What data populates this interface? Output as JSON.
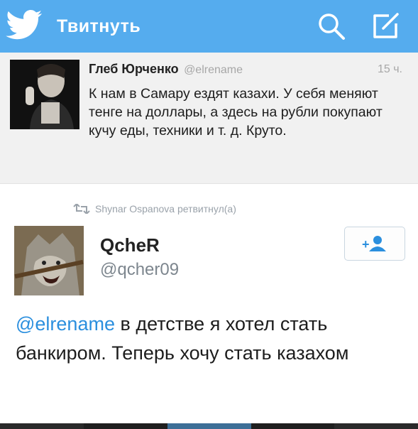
{
  "header": {
    "title": "Твитнуть",
    "brand_color": "#55acee",
    "left_icon": "twitter-bird-icon",
    "search_icon": "search-icon",
    "compose_icon": "compose-icon"
  },
  "original_tweet": {
    "author_name": "Глеб Юрченко",
    "author_handle": "@elrename",
    "time": "15 ч.",
    "text": "К нам в Самару ездят казахи. У себя меняют тенге на доллары, а здесь на рубли покупают кучу еды, техники и т. д. Круто."
  },
  "retweet": {
    "icon": "retweet-icon",
    "text": "Shynar Ospanova ретвитнул(а)"
  },
  "reply_tweet": {
    "author_name": "QcheR",
    "author_handle": "@qcher09",
    "follow_icon": "add-user-icon",
    "mention": "@elrename",
    "text": " в детстве я хотел стать банкиром. Теперь хочу стать казахом",
    "mention_color": "#2b8fde"
  }
}
